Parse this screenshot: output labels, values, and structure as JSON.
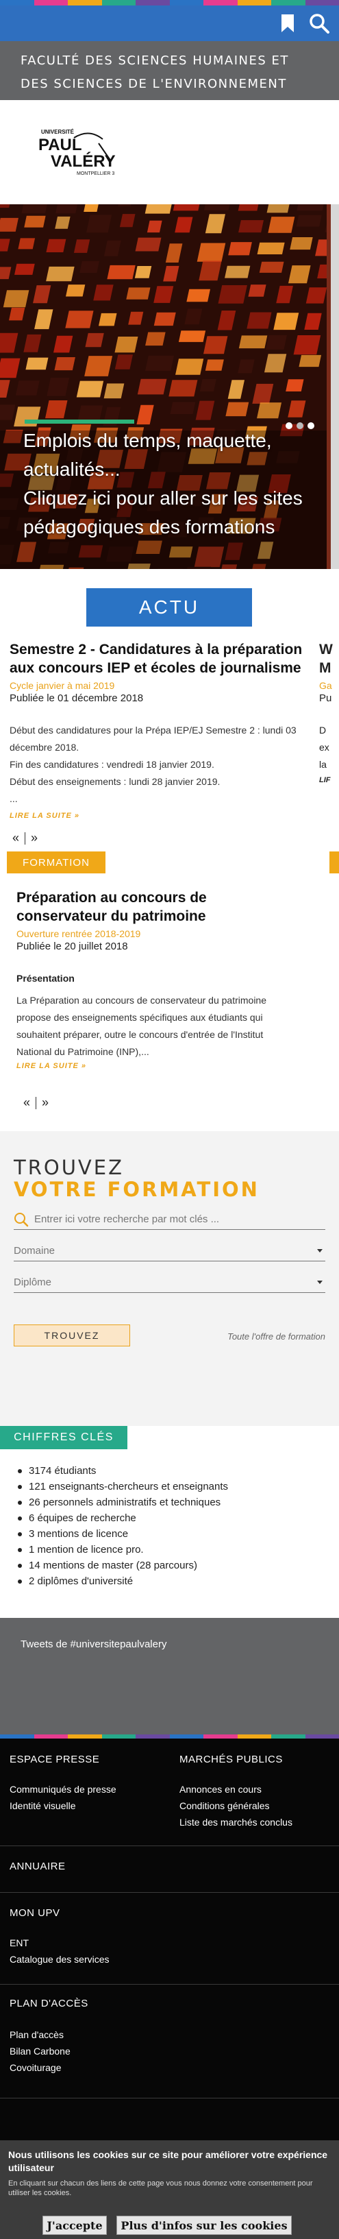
{
  "colors": {
    "stripe": [
      "#2a73c4",
      "#e63c8f",
      "#f0a818",
      "#27a98a",
      "#6a4aa0",
      "#2a73c4",
      "#e63c8f",
      "#f0a818",
      "#27a98a",
      "#6a4aa0"
    ],
    "accent_blue": "#2a73c4",
    "accent_orange": "#f0a818",
    "accent_green": "#27a98a"
  },
  "header": {
    "bookmark_icon": "bookmark-icon",
    "search_icon": "search-icon",
    "faculty_line1": "FACULTÉ DES SCIENCES HUMAINES ET",
    "faculty_line2": "DES SCIENCES DE L'ENVIRONNEMENT"
  },
  "logo": {
    "top": "UNIVERSITÉ",
    "name1": "PAUL",
    "name2": "VALÉRY",
    "city": "MONTPELLIER 3"
  },
  "hero": {
    "line1": "Emplois du temps, maquette,",
    "line2": "actualités...",
    "line3": "Cliquez ici pour aller sur les sites",
    "line4": "pédagogiques des formations",
    "active_slide": 1,
    "slide_count": 3
  },
  "actu": {
    "button": "ACTU",
    "item1": {
      "title_line1": "Semestre 2 - Candidatures à la préparation",
      "title_line2": "aux concours IEP et écoles de journalisme",
      "cycle": "Cycle janvier à mai 2019",
      "date": "Publiée le 01 décembre 2018",
      "body1": "Début des candidatures pour la Prépa IEP/EJ Semestre 2 : lundi 03",
      "body2": "décembre 2018.",
      "body3": "Fin des candidatures : vendredi 18 janvier 2019.",
      "body4": "Début des enseignements : lundi 28 janvier 2019.",
      "body5": "...",
      "more": "LIRE LA SUITE »"
    },
    "peek1": {
      "title1": "W",
      "title2": "M",
      "sub": "Ga",
      "date": "Pu",
      "b1": "D",
      "b2": "ex",
      "b3": "la",
      "more": "LIF"
    },
    "pager_prev": "«",
    "pager_next": "»"
  },
  "formation": {
    "tag": "FORMATION",
    "title_line1": "Préparation au concours de",
    "title_line2": "conservateur du patrimoine",
    "cycle": "Ouverture rentrée 2018-2019",
    "date": "Publiée le 20 juillet 2018",
    "section": "Présentation",
    "body1": "La Préparation au concours de conservateur du patrimoine",
    "body2": "propose des enseignements spécifiques aux étudiants qui",
    "body3": "souhaitent préparer, outre le concours d'entrée de l'Institut",
    "body4": "National du Patrimoine (INP),...",
    "more": "LIRE LA SUITE »",
    "pager_prev": "«",
    "pager_next": "»"
  },
  "trouvez": {
    "title1": "TROUVEZ",
    "title2": "VOTRE FORMATION",
    "search_placeholder": "Entrer ici votre recherche par mot clés ...",
    "domaine": "Domaine",
    "diplome": "Diplôme",
    "button": "TROUVEZ",
    "all_link": "Toute l'offre de formation"
  },
  "chiffres": {
    "tag": "CHIFFRES CLÉS",
    "items": [
      "3174 étudiants",
      "121 enseignants-chercheurs et enseignants",
      "26 personnels administratifs et techniques",
      "6 équipes de recherche",
      "3 mentions de licence",
      "1 mention de licence pro.",
      "14 mentions de master (28 parcours)",
      "2 diplômes d'université"
    ]
  },
  "tweets": {
    "label": "Tweets de #universitepaulvalery"
  },
  "footer": {
    "espace_presse": "ESPACE PRESSE",
    "communiques": "Communiqués de presse",
    "identite": "Identité visuelle",
    "marches": "MARCHÉS PUBLICS",
    "annonces": "Annonces en cours",
    "conditions": "Conditions générales",
    "liste_marches": "Liste des marchés conclus",
    "annuaire": "ANNUAIRE",
    "mon_upv": "MON UPV",
    "ent": "ENT",
    "catalogue": "Catalogue des services",
    "plan_acces": "PLAN D'ACCÈS",
    "plan_acces_link": "Plan d'accès",
    "bilan": "Bilan Carbone",
    "covoiturage": "Covoiturage"
  },
  "cookie": {
    "line1": "Nous utilisons les cookies sur ce site pour améliorer votre expérience",
    "line2": "utilisateur",
    "sub1": "En cliquant sur chacun des liens de cette page vous nous donnez votre consentement pour",
    "sub2": "utiliser les cookies.",
    "accept": "J'accepte",
    "more": "Plus d'infos sur les cookies"
  }
}
